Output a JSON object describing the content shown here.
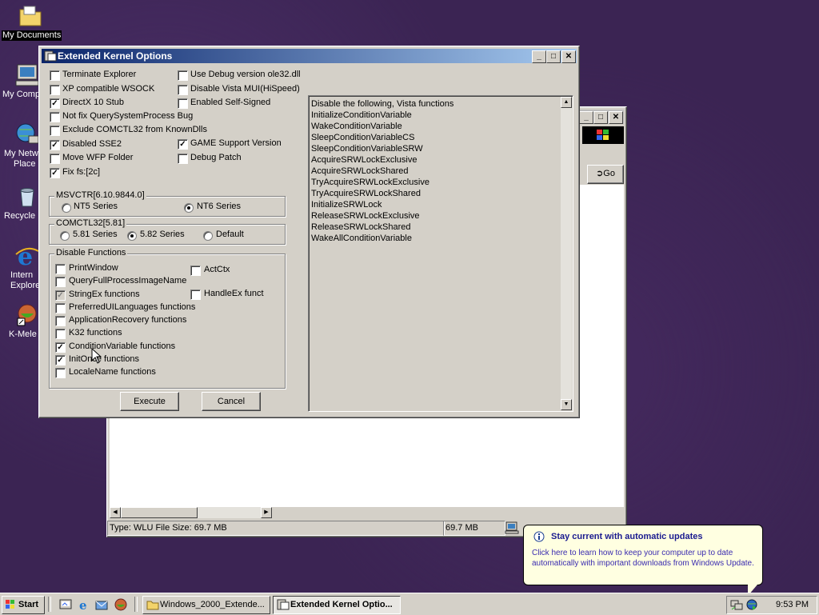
{
  "desktop": {
    "icons": [
      {
        "label": "My Documents",
        "icon": "folder-documents-icon"
      },
      {
        "label": "My Comp",
        "icon": "my-computer-icon"
      },
      {
        "label": "My Netw",
        "label2": "Place",
        "icon": "network-places-icon"
      },
      {
        "label": "Recycle",
        "icon": "recycle-bin-icon"
      },
      {
        "label": "Intern",
        "label2": "Explore",
        "icon": "internet-explorer-icon"
      },
      {
        "label": "K-Mele",
        "icon": "k-meleon-icon"
      }
    ]
  },
  "explorer": {
    "go_label": "Go",
    "status_left": "Type: WLU File Size: 69.7 MB",
    "status_size": "69.7 MB"
  },
  "dialog": {
    "title": "Extended Kernel Options",
    "options_left": [
      {
        "label": "Terminate Explorer",
        "checked": false
      },
      {
        "label": "XP compatible WSOCK",
        "checked": false
      },
      {
        "label": "DirectX 10 Stub",
        "checked": true
      },
      {
        "label": "Not fix QuerySystemProcess Bug",
        "checked": false
      },
      {
        "label": "Exclude COMCTL32 from KnownDlls",
        "checked": false
      },
      {
        "label": "Disabled SSE2",
        "checked": true
      },
      {
        "label": "Move WFP Folder",
        "checked": false
      },
      {
        "label": "Fix fs:[2c]",
        "checked": true
      }
    ],
    "options_right": [
      {
        "label": "Use Debug version ole32.dll",
        "checked": false
      },
      {
        "label": "Disable Vista MUI(HiSpeed)",
        "checked": false
      },
      {
        "label": "Enabled Self-Signed",
        "checked": false
      },
      {
        "label": "GAME Support Version",
        "checked": true
      },
      {
        "label": "Debug Patch",
        "checked": false
      }
    ],
    "msvcrt": {
      "title": "MSVCTR[6.10.9844.0]",
      "options": [
        {
          "label": "NT5 Series",
          "selected": false
        },
        {
          "label": "NT6 Series",
          "selected": true
        }
      ]
    },
    "comctl": {
      "title": "COMCTL32[5.81]",
      "options": [
        {
          "label": "5.81 Series",
          "selected": false
        },
        {
          "label": "5.82 Series",
          "selected": true
        },
        {
          "label": "Default",
          "selected": false
        }
      ]
    },
    "disable_functions": {
      "title": "Disable Functions",
      "left": [
        {
          "label": "PrintWindow",
          "checked": false
        },
        {
          "label": "QueryFullProcessImageName",
          "checked": false
        },
        {
          "label": "StringEx functions",
          "checked": true,
          "disabled": true
        },
        {
          "label": "PreferredUILanguages functions",
          "checked": false
        },
        {
          "label": "ApplicationRecovery functions",
          "checked": false
        },
        {
          "label": "K32 functions",
          "checked": false
        },
        {
          "label": "ConditionVariable functions",
          "checked": true
        },
        {
          "label": "InitOnce functions",
          "checked": true
        },
        {
          "label": "LocaleName functions",
          "checked": false
        }
      ],
      "right": [
        {
          "label": "ActCtx",
          "checked": false
        },
        {
          "label": "HandleEx funct",
          "checked": false
        }
      ]
    },
    "info_lines": [
      "Disable the following, Vista functions",
      "InitializeConditionVariable",
      "WakeConditionVariable",
      "SleepConditionVariableCS",
      "SleepConditionVariableSRW",
      "AcquireSRWLockExclusive",
      "AcquireSRWLockShared",
      "TryAcquireSRWLockExclusive",
      "TryAcquireSRWLockShared",
      "InitializeSRWLock",
      "ReleaseSRWLockExclusive",
      "ReleaseSRWLockShared",
      "WakeAllConditionVariable"
    ],
    "execute_label": "Execute",
    "cancel_label": "Cancel"
  },
  "balloon": {
    "title": "Stay current with automatic updates",
    "body": "Click here to learn how to keep your computer up to date automatically with important downloads from Windows Update."
  },
  "taskbar": {
    "start_label": "Start",
    "tasks": [
      {
        "label": "Windows_2000_Extende...",
        "active": false
      },
      {
        "label": "Extended Kernel Optio...",
        "active": true
      }
    ],
    "clock": "9:53 PM"
  },
  "colors": {
    "desktop": "#3b2453",
    "title_active_start": "#0a246a",
    "title_active_end": "#a6caf0",
    "face": "#d4d0c8",
    "balloon": "#ffffe1"
  }
}
